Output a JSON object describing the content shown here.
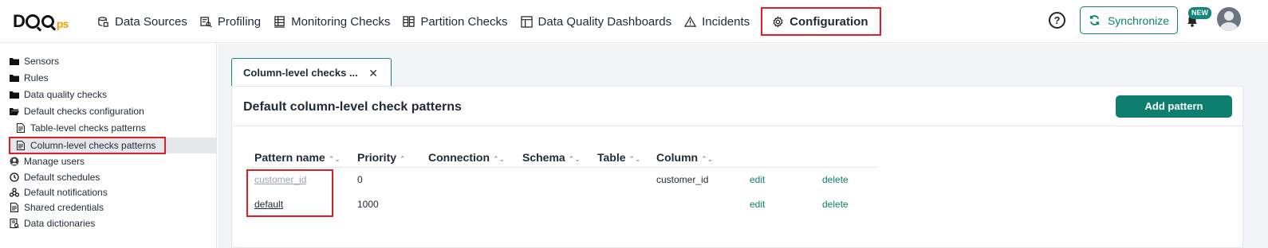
{
  "app": {
    "logo_text": "DQO",
    "logo_suffix": "ps"
  },
  "nav": {
    "items": [
      {
        "label": "Data Sources",
        "icon": "data-sources-icon"
      },
      {
        "label": "Profiling",
        "icon": "profiling-icon"
      },
      {
        "label": "Monitoring Checks",
        "icon": "monitoring-checks-icon"
      },
      {
        "label": "Partition Checks",
        "icon": "partition-checks-icon"
      },
      {
        "label": "Data Quality Dashboards",
        "icon": "dashboard-icon"
      },
      {
        "label": "Incidents",
        "icon": "warning-icon"
      },
      {
        "label": "Configuration",
        "icon": "gear-icon",
        "active": true
      }
    ],
    "help_label": "?",
    "sync_label": "Synchronize",
    "new_badge": "NEW"
  },
  "sidebar": {
    "items": [
      {
        "label": "Sensors",
        "icon": "folder-icon"
      },
      {
        "label": "Rules",
        "icon": "folder-icon"
      },
      {
        "label": "Data quality checks",
        "icon": "folder-icon"
      },
      {
        "label": "Default checks configuration",
        "icon": "folder-open-icon"
      },
      {
        "label": "Table-level checks patterns",
        "icon": "document-icon"
      },
      {
        "label": "Column-level checks patterns",
        "icon": "document-icon",
        "selected": true
      },
      {
        "label": "Manage users",
        "icon": "user-icon"
      },
      {
        "label": "Default schedules",
        "icon": "clock-icon"
      },
      {
        "label": "Default notifications",
        "icon": "notifications-icon"
      },
      {
        "label": "Shared credentials",
        "icon": "credentials-icon"
      },
      {
        "label": "Data dictionaries",
        "icon": "dictionary-icon"
      }
    ]
  },
  "main": {
    "tab_label": "Column-level checks ...",
    "tab_close": "✕",
    "panel_title": "Default column-level check patterns",
    "add_button": "Add pattern",
    "columns": [
      {
        "label": "Pattern name",
        "sort": "⌃⌄"
      },
      {
        "label": "Priority",
        "sort": "⌃"
      },
      {
        "label": "Connection",
        "sort": "⌃⌄"
      },
      {
        "label": "Schema",
        "sort": "⌃⌄"
      },
      {
        "label": "Table",
        "sort": "⌃⌄"
      },
      {
        "label": "Column",
        "sort": "⌃⌄"
      }
    ],
    "rows": [
      {
        "pattern_name": "customer_id",
        "priority": "0",
        "column": "customer_id",
        "edit": "edit",
        "delete": "delete"
      },
      {
        "pattern_name": "default",
        "priority": "1000",
        "column": "",
        "edit": "edit",
        "delete": "delete"
      }
    ]
  },
  "colors": {
    "accent": "#0e7f6e",
    "highlight": "#e11d2a"
  }
}
